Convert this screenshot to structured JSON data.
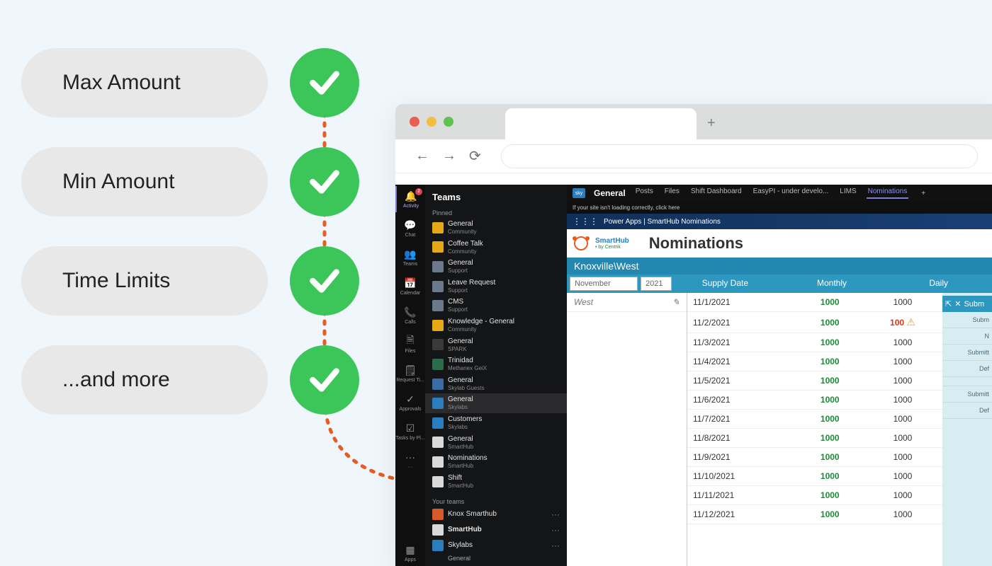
{
  "features": [
    "Max Amount",
    "Min Amount",
    "Time Limits",
    "...and more"
  ],
  "colors": {
    "check": "#3cc65a",
    "accent": "#e65c23",
    "teal": "#2e97bf",
    "link": "#7b7ed4"
  },
  "rail": [
    {
      "label": "Activity",
      "active": true,
      "badge": "2"
    },
    {
      "label": "Chat"
    },
    {
      "label": "Teams"
    },
    {
      "label": "Calendar"
    },
    {
      "label": "Calls"
    },
    {
      "label": "Files"
    },
    {
      "label": "Request Ti..."
    },
    {
      "label": "Approvals"
    },
    {
      "label": "Tasks by Pl..."
    },
    {
      "label": "···"
    }
  ],
  "rail_bottom": {
    "label": "Apps"
  },
  "teams_header": "Teams",
  "pinned_label": "Pinned",
  "pinned": [
    {
      "name": "General",
      "sub": "Community",
      "bg": "#e6a817"
    },
    {
      "name": "Coffee Talk",
      "sub": "Community",
      "bg": "#e6a817"
    },
    {
      "name": "General",
      "sub": "Support",
      "bg": "#6a7a8c"
    },
    {
      "name": "Leave Request",
      "sub": "Support",
      "bg": "#6a7a8c"
    },
    {
      "name": "CMS",
      "sub": "Support",
      "bg": "#6a7a8c"
    },
    {
      "name": "Knowledge - General",
      "sub": "Community",
      "bg": "#e6a817"
    },
    {
      "name": "General",
      "sub": "SPARK",
      "bg": "#3a3a3a"
    },
    {
      "name": "Trinidad",
      "sub": "Methanex GeiX",
      "bg": "#2b6d4a"
    },
    {
      "name": "General",
      "sub": "Skylab Guests",
      "bg": "#3a6da8"
    },
    {
      "name": "General",
      "sub": "Skylabs",
      "bg": "#2a7ebd",
      "sel": true
    },
    {
      "name": "Customers",
      "sub": "Skylabs",
      "bg": "#2a7ebd"
    },
    {
      "name": "General",
      "sub": "SmartHub",
      "bg": "#d9d9d9"
    },
    {
      "name": "Nominations",
      "sub": "SmartHub",
      "bg": "#d9d9d9"
    },
    {
      "name": "Shift",
      "sub": "SmartHub",
      "bg": "#d9d9d9"
    }
  ],
  "yourteams_label": "Your teams",
  "yourteams": [
    {
      "name": "Knox Smarthub",
      "bg": "#d75a2a"
    },
    {
      "name": "SmartHub",
      "bg": "#d9d9d9",
      "bold": true
    },
    {
      "name": "Skylabs",
      "bg": "#2a7ebd",
      "children": [
        "General"
      ]
    }
  ],
  "channel": {
    "icon": "sky",
    "name": "General",
    "tabs": [
      "Posts",
      "Files",
      "Shift Dashboard",
      "EasyPI - under develo...",
      "LIMS",
      "Nominations"
    ],
    "active_tab": "Nominations"
  },
  "notice": "If your site isn't loading correctly, click here",
  "appbar": "Power Apps  |  SmartHub Nominations",
  "smarthub": {
    "brand": "SmartHub",
    "brand_sub": "• by Centrik",
    "title": "Nominations"
  },
  "breadcrumb": "Knoxville\\West",
  "filters": {
    "month": "November",
    "year": "2021",
    "cols": [
      "Supply Date",
      "Monthly",
      "Daily"
    ],
    "side": "Subm"
  },
  "location": "West",
  "rows": [
    {
      "date": "11/1/2021",
      "monthly": "1000",
      "daily": "1000"
    },
    {
      "date": "11/2/2021",
      "monthly": "1000",
      "daily": "100",
      "warn": true
    },
    {
      "date": "11/3/2021",
      "monthly": "1000",
      "daily": "1000"
    },
    {
      "date": "11/4/2021",
      "monthly": "1000",
      "daily": "1000"
    },
    {
      "date": "11/5/2021",
      "monthly": "1000",
      "daily": "1000"
    },
    {
      "date": "11/6/2021",
      "monthly": "1000",
      "daily": "1000"
    },
    {
      "date": "11/7/2021",
      "monthly": "1000",
      "daily": "1000"
    },
    {
      "date": "11/8/2021",
      "monthly": "1000",
      "daily": "1000"
    },
    {
      "date": "11/9/2021",
      "monthly": "1000",
      "daily": "1000"
    },
    {
      "date": "11/10/2021",
      "monthly": "1000",
      "daily": "1000"
    },
    {
      "date": "11/11/2021",
      "monthly": "1000",
      "daily": "1000"
    },
    {
      "date": "11/12/2021",
      "monthly": "1000",
      "daily": "1000"
    }
  ],
  "side_rows": [
    "Subm",
    "N",
    "Submitt",
    "Def",
    "",
    "Submitt",
    "Def"
  ]
}
